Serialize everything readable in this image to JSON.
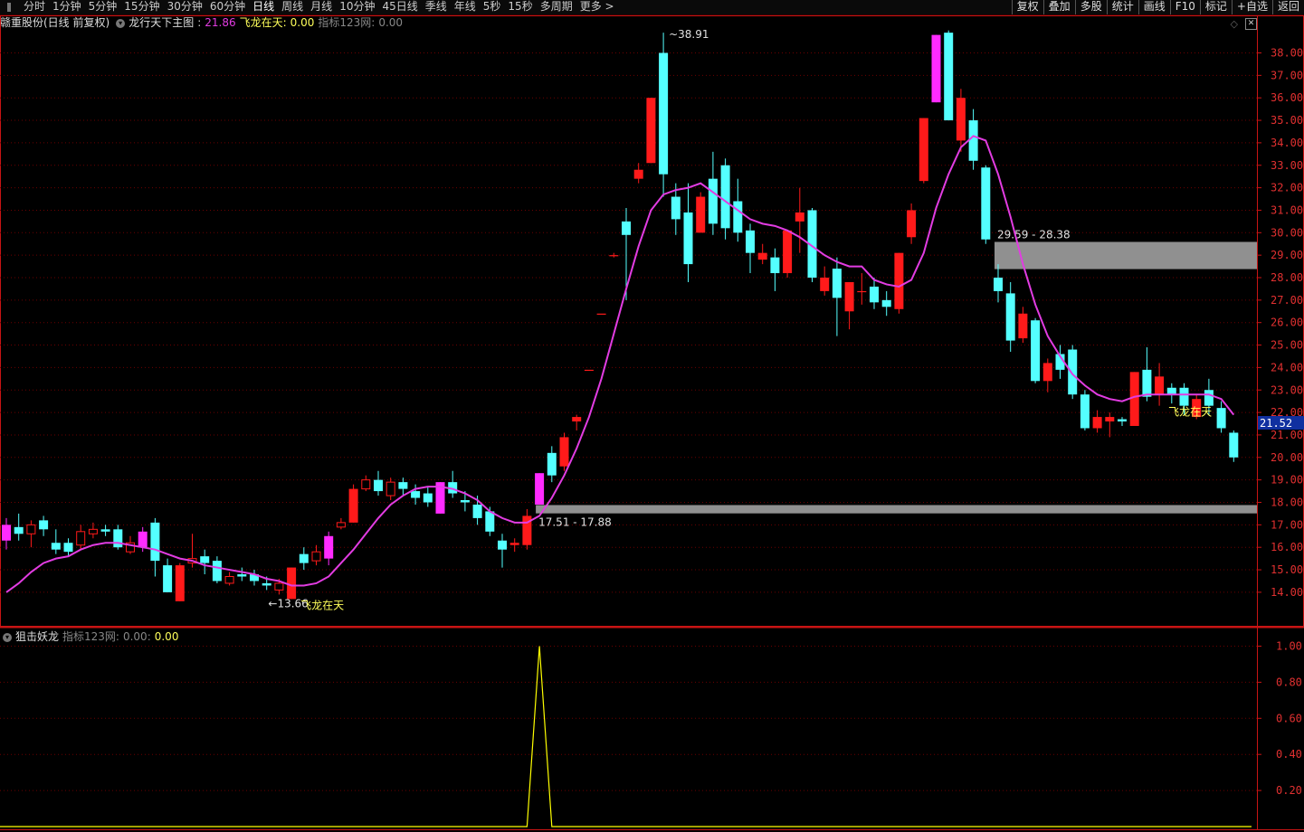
{
  "toolbar": {
    "periods": [
      "分时",
      "1分钟",
      "5分钟",
      "15分钟",
      "30分钟",
      "60分钟",
      "日线",
      "周线",
      "月线",
      "10分钟",
      "45日线",
      "季线",
      "年线",
      "5秒",
      "15秒",
      "多周期",
      "更多 >"
    ],
    "active_period": "日线",
    "right_tools": [
      "复权",
      "叠加",
      "多股",
      "统计",
      "画线",
      "F10",
      "标记",
      "+自选",
      "返回"
    ]
  },
  "main_header": {
    "stock": "赣重股份(日线 前复权)",
    "indicator_name": "龙行天下主图",
    "indicator_value": "21.86",
    "flag_label": "飞龙在天",
    "flag_value": "0.00",
    "aux_label": "指标123网",
    "aux_value": "0.00"
  },
  "sub_header": {
    "name": "狙击妖龙",
    "aux_label": "指标123网",
    "aux_value": "0.00",
    "value": "0.00"
  },
  "colors": {
    "up": "#ff1a1a",
    "down": "#54ffff",
    "signal": "#ff2bff",
    "ma": "#e23ce2",
    "grid": "#6b0000",
    "axis": "#c81414",
    "zone": "#909090",
    "label_yellow": "#ffff5a",
    "price_tag_bg": "#1030a0",
    "sub_line": "#ffff00"
  },
  "chart_data": [
    {
      "type": "candlestick",
      "title": "赣重股份(日线 前复权)",
      "ylim": [
        13,
        39
      ],
      "yticks": [
        "14.00",
        "15.00",
        "16.00",
        "17.00",
        "18.00",
        "19.00",
        "20.00",
        "21.00",
        "22.00",
        "23.00",
        "24.00",
        "25.00",
        "26.00",
        "27.00",
        "28.00",
        "29.00",
        "30.00",
        "31.00",
        "32.00",
        "33.00",
        "34.00",
        "35.00",
        "36.00",
        "37.00",
        "38.00"
      ],
      "grid": true,
      "last_price_tag": "21.52",
      "candles": [
        [
          16.3,
          17.0,
          17.3,
          15.9,
          "signal"
        ],
        [
          16.9,
          16.6,
          17.5,
          16.3,
          "down"
        ],
        [
          16.6,
          17.0,
          17.2,
          16.0,
          "up"
        ],
        [
          17.2,
          16.8,
          17.4,
          16.5,
          "down"
        ],
        [
          15.9,
          16.2,
          16.8,
          15.7,
          "down"
        ],
        [
          16.2,
          15.8,
          16.4,
          15.6,
          "down"
        ],
        [
          16.1,
          16.7,
          17.0,
          15.9,
          "up"
        ],
        [
          16.6,
          16.8,
          17.1,
          16.4,
          "up"
        ],
        [
          16.8,
          16.7,
          17.0,
          16.5,
          "down"
        ],
        [
          16.8,
          16.0,
          17.0,
          15.9,
          "down"
        ],
        [
          15.8,
          16.2,
          16.5,
          15.7,
          "up"
        ],
        [
          16.0,
          16.7,
          16.9,
          15.8,
          "signal"
        ],
        [
          17.1,
          15.4,
          17.3,
          14.7,
          "down"
        ],
        [
          15.2,
          14.0,
          15.5,
          14.0,
          "down"
        ],
        [
          13.6,
          15.2,
          15.3,
          13.6,
          "up"
        ],
        [
          15.3,
          15.5,
          16.6,
          15.1,
          "up"
        ],
        [
          15.6,
          15.3,
          15.9,
          14.8,
          "down"
        ],
        [
          15.4,
          14.5,
          15.6,
          14.4,
          "down"
        ],
        [
          14.4,
          14.7,
          14.9,
          14.3,
          "up"
        ],
        [
          14.7,
          14.8,
          15.1,
          14.5,
          "down"
        ],
        [
          14.8,
          14.5,
          15.0,
          14.3,
          "down"
        ],
        [
          14.3,
          14.4,
          14.7,
          14.1,
          "down"
        ],
        [
          14.1,
          14.4,
          14.6,
          13.9,
          "up"
        ],
        [
          13.7,
          15.1,
          15.1,
          13.7,
          "up"
        ],
        [
          15.3,
          15.7,
          16.0,
          15.0,
          "down"
        ],
        [
          15.4,
          15.8,
          16.1,
          15.2,
          "up"
        ],
        [
          15.5,
          16.5,
          16.7,
          15.2,
          "signal"
        ],
        [
          16.9,
          17.1,
          17.3,
          16.8,
          "up"
        ],
        [
          17.1,
          18.6,
          18.8,
          17.1,
          "up"
        ],
        [
          18.6,
          19.0,
          19.2,
          18.5,
          "up"
        ],
        [
          19.0,
          18.5,
          19.4,
          18.3,
          "down"
        ],
        [
          18.3,
          18.9,
          19.1,
          18.1,
          "up"
        ],
        [
          18.9,
          18.6,
          19.1,
          18.3,
          "down"
        ],
        [
          18.5,
          18.2,
          18.8,
          17.9,
          "down"
        ],
        [
          18.4,
          18.0,
          18.7,
          17.8,
          "down"
        ],
        [
          17.5,
          18.9,
          18.9,
          17.5,
          "signal"
        ],
        [
          18.9,
          18.4,
          19.4,
          18.2,
          "down"
        ],
        [
          18.0,
          18.1,
          18.5,
          17.6,
          "down"
        ],
        [
          17.9,
          17.3,
          18.3,
          17.0,
          "down"
        ],
        [
          17.6,
          16.7,
          17.8,
          16.5,
          "down"
        ],
        [
          16.3,
          15.9,
          16.6,
          15.1,
          "down"
        ],
        [
          16.1,
          16.2,
          16.4,
          15.8,
          "up"
        ],
        [
          16.1,
          17.4,
          17.7,
          15.9,
          "up"
        ],
        [
          17.9,
          19.3,
          19.3,
          17.9,
          "signal"
        ],
        [
          19.2,
          20.2,
          20.5,
          18.9,
          "down"
        ],
        [
          19.6,
          20.9,
          21.1,
          19.4,
          "up"
        ],
        [
          21.6,
          21.8,
          21.9,
          21.2,
          "up"
        ],
        [
          23.9,
          23.9,
          23.9,
          23.9,
          "up"
        ],
        [
          26.4,
          26.4,
          26.4,
          26.4,
          "up"
        ],
        [
          29.0,
          29.0,
          29.1,
          28.9,
          "up"
        ],
        [
          30.5,
          29.9,
          31.1,
          27.0,
          "down"
        ],
        [
          32.4,
          32.8,
          33.1,
          32.2,
          "up"
        ],
        [
          33.1,
          36.0,
          36.0,
          33.1,
          "up"
        ],
        [
          38.0,
          32.6,
          38.9,
          31.6,
          "down"
        ],
        [
          31.6,
          30.6,
          32.2,
          29.9,
          "down"
        ],
        [
          30.9,
          28.6,
          32.2,
          27.8,
          "down"
        ],
        [
          30.0,
          31.6,
          31.8,
          30.0,
          "up"
        ],
        [
          32.4,
          30.4,
          33.6,
          29.9,
          "down"
        ],
        [
          33.0,
          30.2,
          33.3,
          29.7,
          "down"
        ],
        [
          31.4,
          30.0,
          32.4,
          29.6,
          "down"
        ],
        [
          30.1,
          29.1,
          30.4,
          28.2,
          "down"
        ],
        [
          29.1,
          28.8,
          29.5,
          28.6,
          "up"
        ],
        [
          28.9,
          28.2,
          29.3,
          27.4,
          "down"
        ],
        [
          28.2,
          30.1,
          30.1,
          28.0,
          "up"
        ],
        [
          30.5,
          30.9,
          32.0,
          29.1,
          "up"
        ],
        [
          31.0,
          28.0,
          31.1,
          27.8,
          "down"
        ],
        [
          28.0,
          27.4,
          28.5,
          27.2,
          "up"
        ],
        [
          28.4,
          27.1,
          28.9,
          25.4,
          "down"
        ],
        [
          26.5,
          27.8,
          27.8,
          25.7,
          "up"
        ],
        [
          27.4,
          27.4,
          28.2,
          26.8,
          "up"
        ],
        [
          27.6,
          26.9,
          28.0,
          26.6,
          "down"
        ],
        [
          27.0,
          26.7,
          27.4,
          26.3,
          "down"
        ],
        [
          26.6,
          29.1,
          29.1,
          26.4,
          "up"
        ],
        [
          29.8,
          31.0,
          31.3,
          29.5,
          "up"
        ],
        [
          32.3,
          35.1,
          35.1,
          32.2,
          "up"
        ],
        [
          38.8,
          35.8,
          38.8,
          35.8,
          "signal"
        ],
        [
          38.9,
          35.0,
          39.0,
          35.0,
          "down"
        ],
        [
          34.1,
          36.0,
          36.4,
          33.6,
          "up"
        ],
        [
          35.0,
          33.2,
          35.5,
          32.8,
          "down"
        ],
        [
          32.9,
          29.7,
          33.0,
          29.5,
          "down"
        ],
        [
          28.0,
          27.4,
          28.6,
          26.9,
          "down"
        ],
        [
          27.3,
          25.2,
          27.8,
          24.7,
          "down"
        ],
        [
          26.4,
          25.3,
          26.7,
          25.1,
          "up"
        ],
        [
          26.1,
          23.4,
          26.2,
          23.3,
          "down"
        ],
        [
          23.4,
          24.2,
          24.4,
          22.9,
          "up"
        ],
        [
          24.6,
          23.9,
          25.0,
          23.5,
          "down"
        ],
        [
          24.8,
          22.8,
          25.0,
          22.6,
          "down"
        ],
        [
          22.8,
          21.3,
          23.0,
          21.2,
          "down"
        ],
        [
          21.3,
          21.8,
          22.1,
          21.1,
          "up"
        ],
        [
          21.6,
          21.8,
          22.0,
          20.9,
          "up"
        ],
        [
          21.7,
          21.6,
          21.8,
          21.4,
          "down"
        ],
        [
          21.4,
          23.8,
          23.8,
          21.4,
          "up"
        ],
        [
          23.9,
          22.7,
          24.9,
          22.5,
          "down"
        ],
        [
          22.8,
          23.6,
          24.2,
          22.3,
          "up"
        ],
        [
          23.1,
          22.8,
          23.3,
          22.4,
          "down"
        ],
        [
          23.1,
          22.3,
          23.3,
          21.9,
          "down"
        ],
        [
          21.8,
          22.6,
          22.8,
          21.7,
          "up"
        ],
        [
          23.0,
          22.3,
          23.5,
          21.9,
          "down"
        ],
        [
          22.2,
          21.3,
          22.5,
          21.1,
          "down"
        ],
        [
          21.1,
          20.0,
          21.2,
          19.8,
          "down"
        ]
      ],
      "ma": [
        14.0,
        14.4,
        14.9,
        15.3,
        15.5,
        15.6,
        15.9,
        16.1,
        16.2,
        16.2,
        16.1,
        16.0,
        15.9,
        15.7,
        15.5,
        15.4,
        15.2,
        15.1,
        15.0,
        14.9,
        14.8,
        14.6,
        14.5,
        14.3,
        14.3,
        14.4,
        14.7,
        15.3,
        15.9,
        16.6,
        17.3,
        17.9,
        18.3,
        18.6,
        18.7,
        18.7,
        18.6,
        18.4,
        18.1,
        17.6,
        17.3,
        17.1,
        17.1,
        17.4,
        18.2,
        19.2,
        20.4,
        21.8,
        23.5,
        25.5,
        27.5,
        29.4,
        31.0,
        31.7,
        31.9,
        32.0,
        32.2,
        31.8,
        31.4,
        31.0,
        30.6,
        30.4,
        30.3,
        30.1,
        29.8,
        29.4,
        29.0,
        28.7,
        28.5,
        28.5,
        27.9,
        27.7,
        27.6,
        27.9,
        29.1,
        31.1,
        32.6,
        33.8,
        34.3,
        34.1,
        32.6,
        30.7,
        28.6,
        26.8,
        25.4,
        24.5,
        23.7,
        23.2,
        22.8,
        22.6,
        22.5,
        22.7,
        22.8,
        22.8,
        22.8,
        22.8,
        22.8,
        22.8,
        22.6,
        21.9
      ],
      "annotations": [
        {
          "candle": 53,
          "text": "38.91",
          "kind": "hi"
        },
        {
          "candle": 22,
          "text": "13.66",
          "kind": "lo"
        }
      ],
      "signals": [
        {
          "candle": 23,
          "text": "飞龙在天"
        },
        {
          "candle": 93,
          "text": "飞龙在天"
        }
      ],
      "zones": [
        {
          "from_candle": 43,
          "low": 17.51,
          "high": 17.88,
          "label": "17.51 - 17.88"
        },
        {
          "from_candle": 80,
          "low": 28.38,
          "high": 29.59,
          "label": "29.59 - 28.38"
        }
      ]
    },
    {
      "type": "line",
      "title": "狙击妖龙",
      "ylim": [
        0,
        1.07
      ],
      "yticks": [
        "0.20",
        "0.40",
        "0.60",
        "0.80",
        "1.00"
      ],
      "grid": true,
      "spike": {
        "candle": 43,
        "value": 1.0
      }
    }
  ]
}
